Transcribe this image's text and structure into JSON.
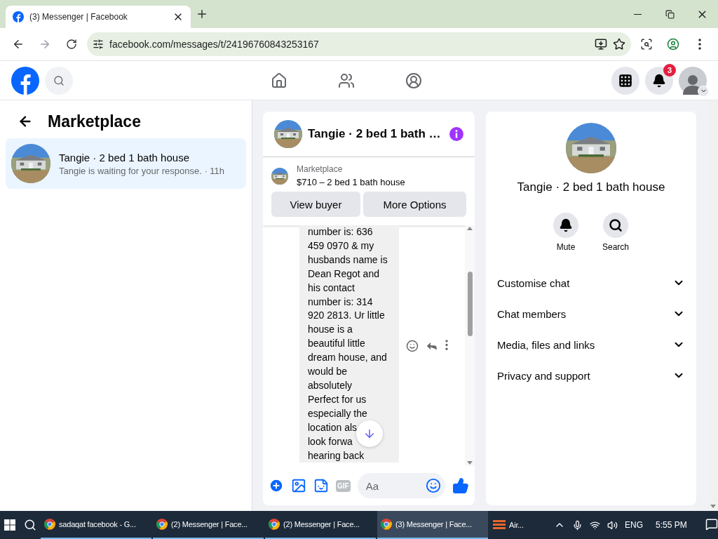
{
  "browser": {
    "tabs": [
      {
        "title": "(3) Messenger | Facebook",
        "selected": true
      }
    ],
    "url": "facebook.com/messages/t/24196760843253167"
  },
  "header": {
    "notification_count": "3"
  },
  "sidebar": {
    "title": "Marketplace",
    "conversations": [
      {
        "title": "Tangie · 2 bed 1 bath house",
        "preview": "Tangie is waiting for your response. · 11h",
        "selected": true
      }
    ]
  },
  "chat": {
    "title": "Tangie · 2 bed 1 bath …",
    "listing": {
      "label": "Marketplace",
      "title": "$710 – 2 bed 1 bath house"
    },
    "buttons": [
      "View buyer",
      "More Options"
    ],
    "message_lines": [
      "number is: 636",
      "459 0970 & my",
      "husbands name is",
      "Dean Regot and",
      "his contact",
      "number is: 314",
      "920 2813. Ur little",
      "house is a",
      "beautiful little",
      "dream house, and",
      "would be",
      "absolutely",
      "Perfect for us",
      "especially the",
      "location als",
      "look forwa",
      "hearing back"
    ],
    "composer": {
      "gif_label": "GIF",
      "placeholder": "Aa"
    }
  },
  "details": {
    "title": "Tangie · 2 bed 1 bath house",
    "actions": [
      {
        "label": "Mute",
        "kind": "mute"
      },
      {
        "label": "Search",
        "kind": "search"
      }
    ],
    "sections": [
      {
        "label": "Customise chat",
        "expanded": false
      },
      {
        "label": "Chat members",
        "expanded": false
      },
      {
        "label": "Media, files and links",
        "expanded": false
      },
      {
        "label": "Privacy and support",
        "expanded": false
      }
    ]
  },
  "taskbar": {
    "items": [
      {
        "label": "sadaqat facebook - G...",
        "selected": false
      },
      {
        "label": "(2) Messenger | Face...",
        "selected": false
      },
      {
        "label": "(2) Messenger | Face...",
        "selected": false
      },
      {
        "label": "(3) Messenger | Face...",
        "selected": true
      }
    ],
    "weather": "Air...",
    "language": "ENG",
    "time": "5:55 PM"
  }
}
